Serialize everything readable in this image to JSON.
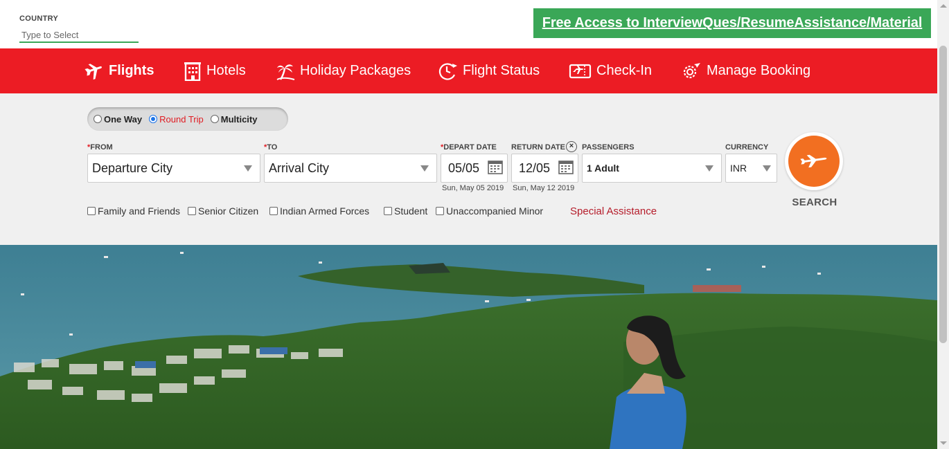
{
  "country": {
    "label": "COUNTRY",
    "placeholder": "Type to Select"
  },
  "promo": {
    "text": "Free Access to InterviewQues/ResumeAssistance/Material"
  },
  "nav": {
    "items": [
      {
        "label": "Flights",
        "icon": "airplane-icon",
        "active": true
      },
      {
        "label": "Hotels",
        "icon": "hotel-icon"
      },
      {
        "label": "Holiday Packages",
        "icon": "palm-tree-icon"
      },
      {
        "label": "Flight Status",
        "icon": "clock-plane-icon"
      },
      {
        "label": "Check-In",
        "icon": "ticket-icon"
      },
      {
        "label": "Manage Booking",
        "icon": "gear-plane-icon"
      }
    ]
  },
  "trip": {
    "one_way": "One Way",
    "round_trip": "Round Trip",
    "multicity": "Multicity",
    "selected": "Round Trip"
  },
  "form": {
    "from_label": "FROM",
    "from_value": "Departure City",
    "to_label": "TO",
    "to_value": "Arrival City",
    "depart_label": "DEPART DATE",
    "depart_value": "05/05",
    "depart_sub": "Sun, May 05 2019",
    "return_label": "RETURN DATE",
    "return_value": "12/05",
    "return_sub": "Sun, May 12 2019",
    "passengers_label": "PASSENGERS",
    "passengers_value": "1 Adult",
    "currency_label": "CURRENCY",
    "currency_value": "INR",
    "required_mark": "*",
    "clear_icon": "close-circle-icon"
  },
  "options": {
    "family": "Family and Friends",
    "senior": "Senior Citizen",
    "armed": "Indian Armed Forces",
    "student": "Student",
    "minor": "Unaccompanied Minor",
    "special": "Special Assistance"
  },
  "search": {
    "label": "SEARCH"
  },
  "colors": {
    "brand_red": "#ec1c24",
    "accent_green": "#3aa757",
    "search_orange": "#f26f21",
    "panel_gray": "#f0f0f0"
  }
}
